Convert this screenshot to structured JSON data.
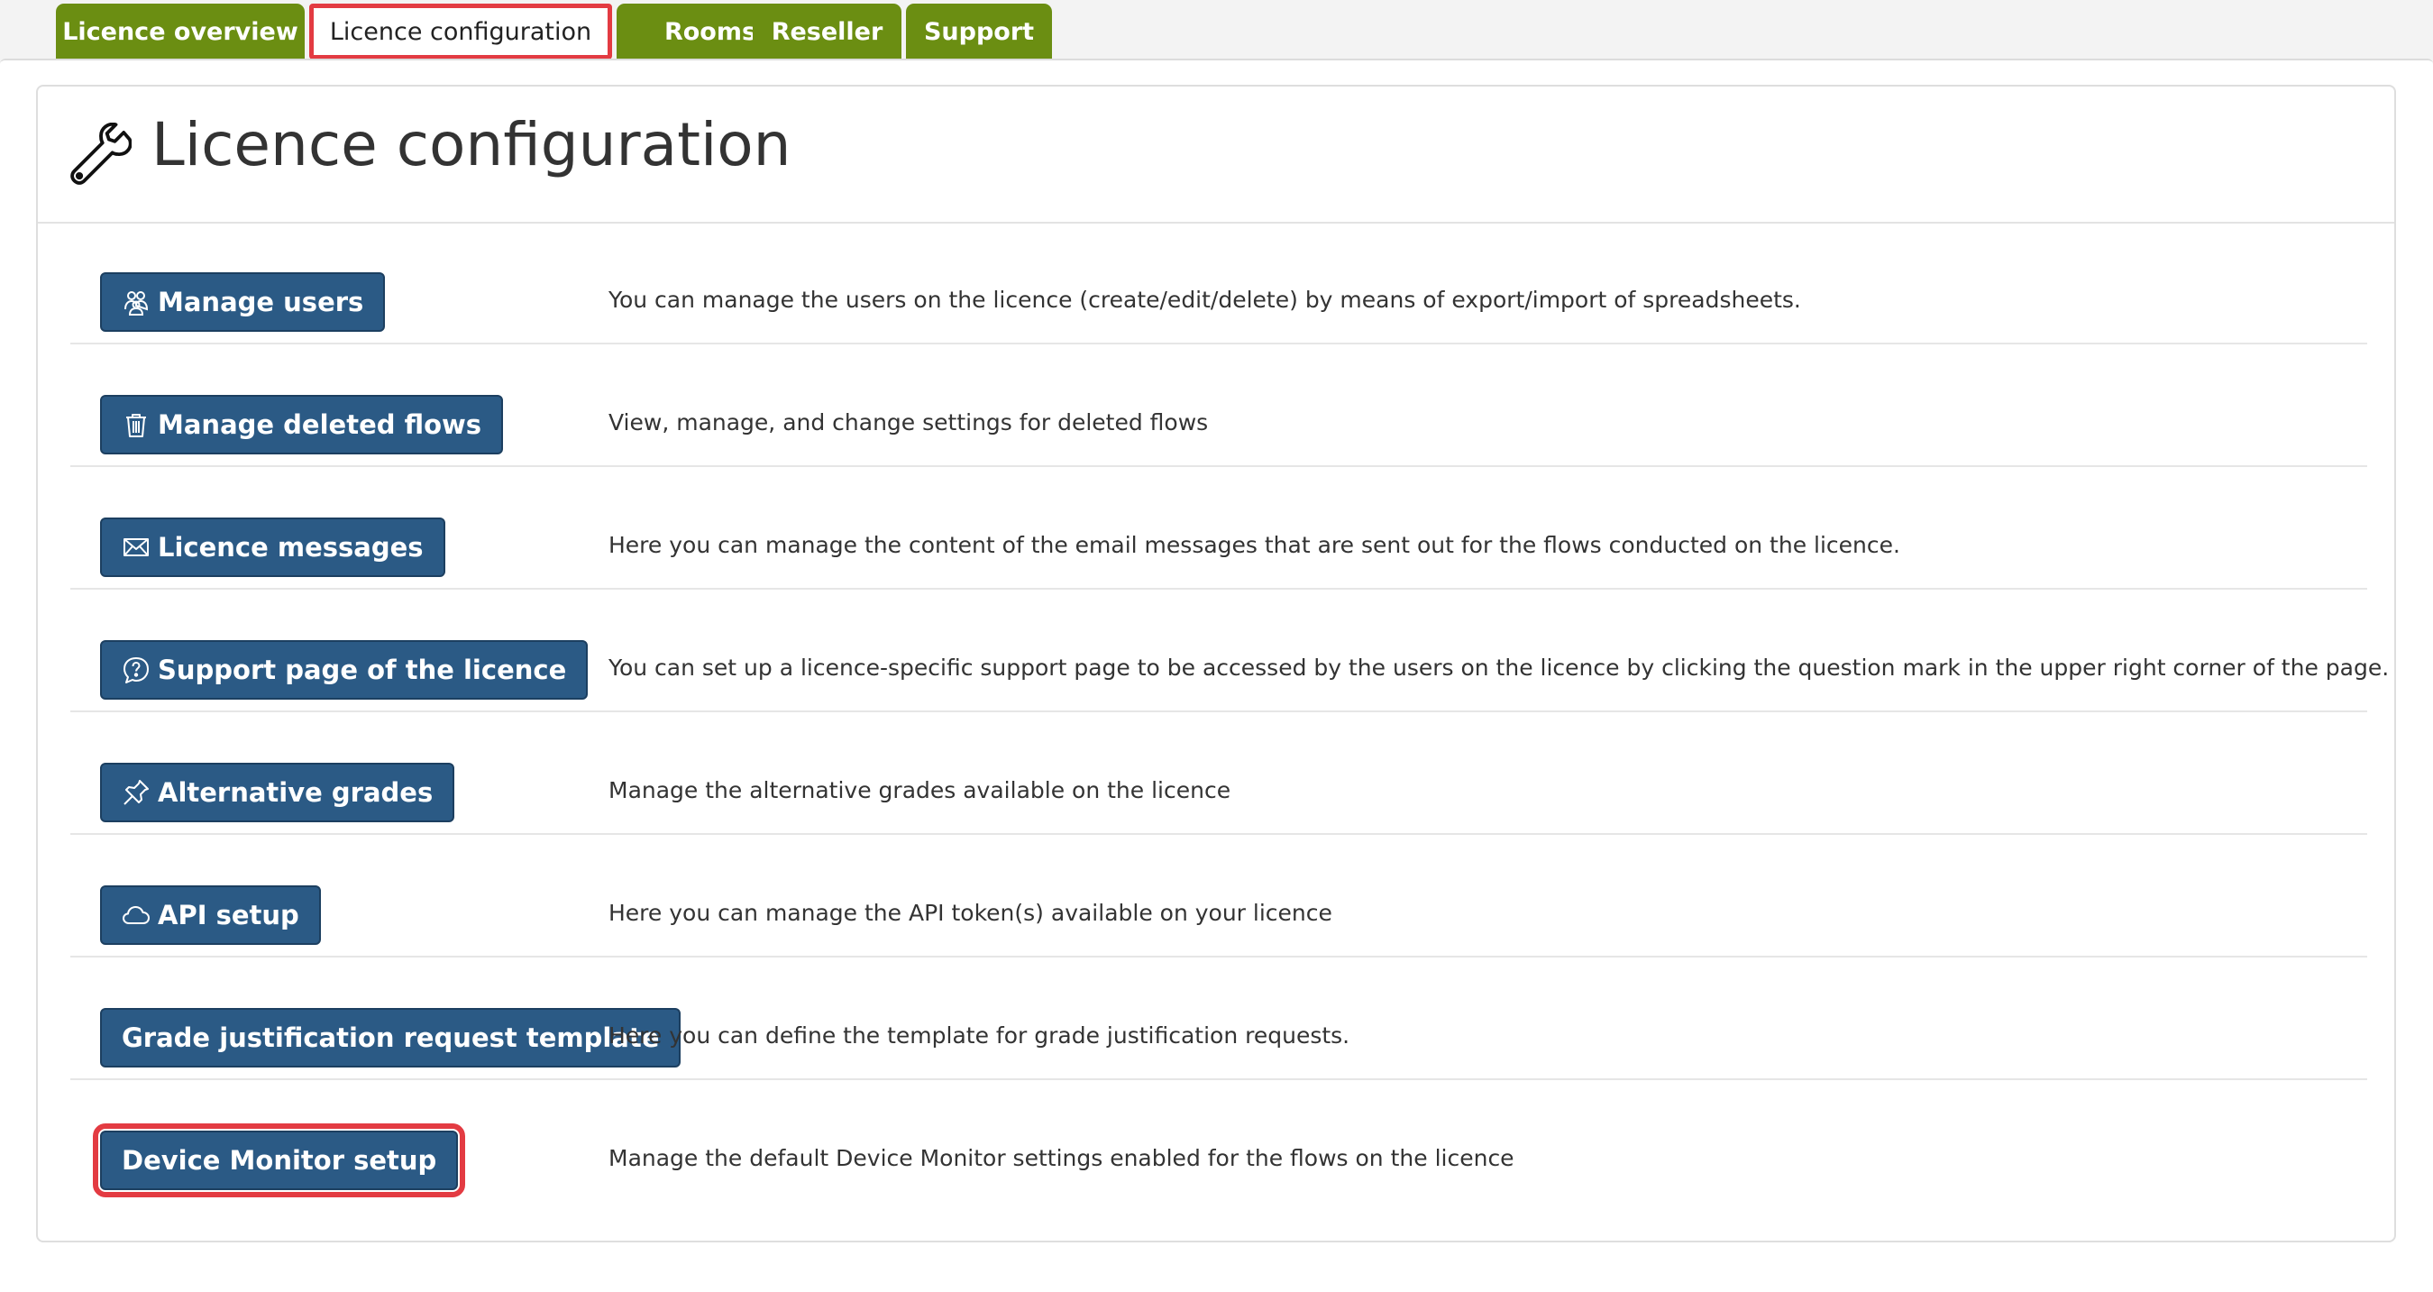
{
  "tabs": [
    {
      "label": "Licence overview",
      "active": false
    },
    {
      "label": "Licence configuration",
      "active": true
    },
    {
      "label": "Rooms",
      "active": false
    },
    {
      "label": "Reseller",
      "active": false
    },
    {
      "label": "Support",
      "active": false
    }
  ],
  "page": {
    "title": "Licence configuration",
    "title_icon": "wrench-icon"
  },
  "items": [
    {
      "button": "Manage users",
      "icon": "users-icon",
      "description": "You can manage the users on the licence (create/edit/delete) by means of export/import of spreadsheets."
    },
    {
      "button": "Manage deleted flows",
      "icon": "trash-icon",
      "description": "View, manage, and change settings for deleted flows"
    },
    {
      "button": "Licence messages",
      "icon": "envelope-icon",
      "description": "Here you can manage the content of the email messages that are sent out for the flows conducted on the licence."
    },
    {
      "button": "Support page of the licence",
      "icon": "question-bubble-icon",
      "description": "You can set up a licence-specific support page to be accessed by the users on the licence by clicking the question mark in the upper right corner of the page."
    },
    {
      "button": "Alternative grades",
      "icon": "pin-icon",
      "description": "Manage the alternative grades available on the licence"
    },
    {
      "button": "API setup",
      "icon": "cloud-icon",
      "description": "Here you can manage the API token(s) available on your licence"
    },
    {
      "button": "Grade justification request template",
      "icon": "",
      "description": "Here you can define the template for grade justification requests."
    },
    {
      "button": "Device Monitor setup",
      "icon": "",
      "description": "Manage the default Device Monitor settings enabled for the flows on the licence",
      "highlighted": true
    }
  ],
  "colors": {
    "tab_green": "#6b8e12",
    "button_blue": "#2b5a85",
    "highlight_red": "#e33b42"
  }
}
